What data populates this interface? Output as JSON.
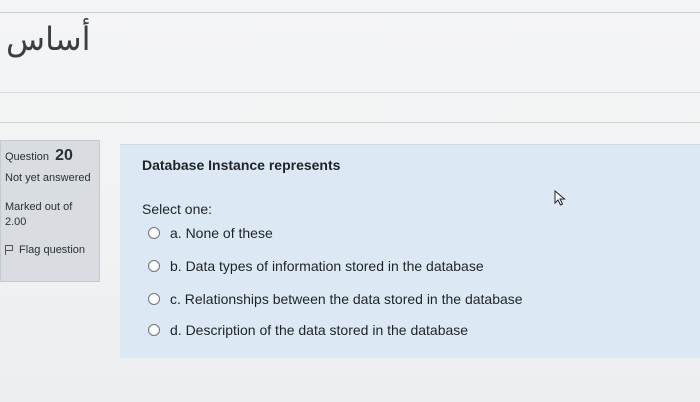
{
  "course": {
    "title": "أساس"
  },
  "question_info": {
    "label": "Question",
    "number": "20",
    "state": "Not yet answered",
    "grade": "Marked out of 2.00",
    "flag_label": "Flag question"
  },
  "question": {
    "text": "Database Instance represents",
    "prompt": "Select one:",
    "options": [
      {
        "label": "a. None of these"
      },
      {
        "label": "b. Data types of information stored in the database"
      },
      {
        "label": "c. Relationships between the data stored in the database"
      },
      {
        "label": "d. Description of the data stored in the database"
      }
    ]
  }
}
